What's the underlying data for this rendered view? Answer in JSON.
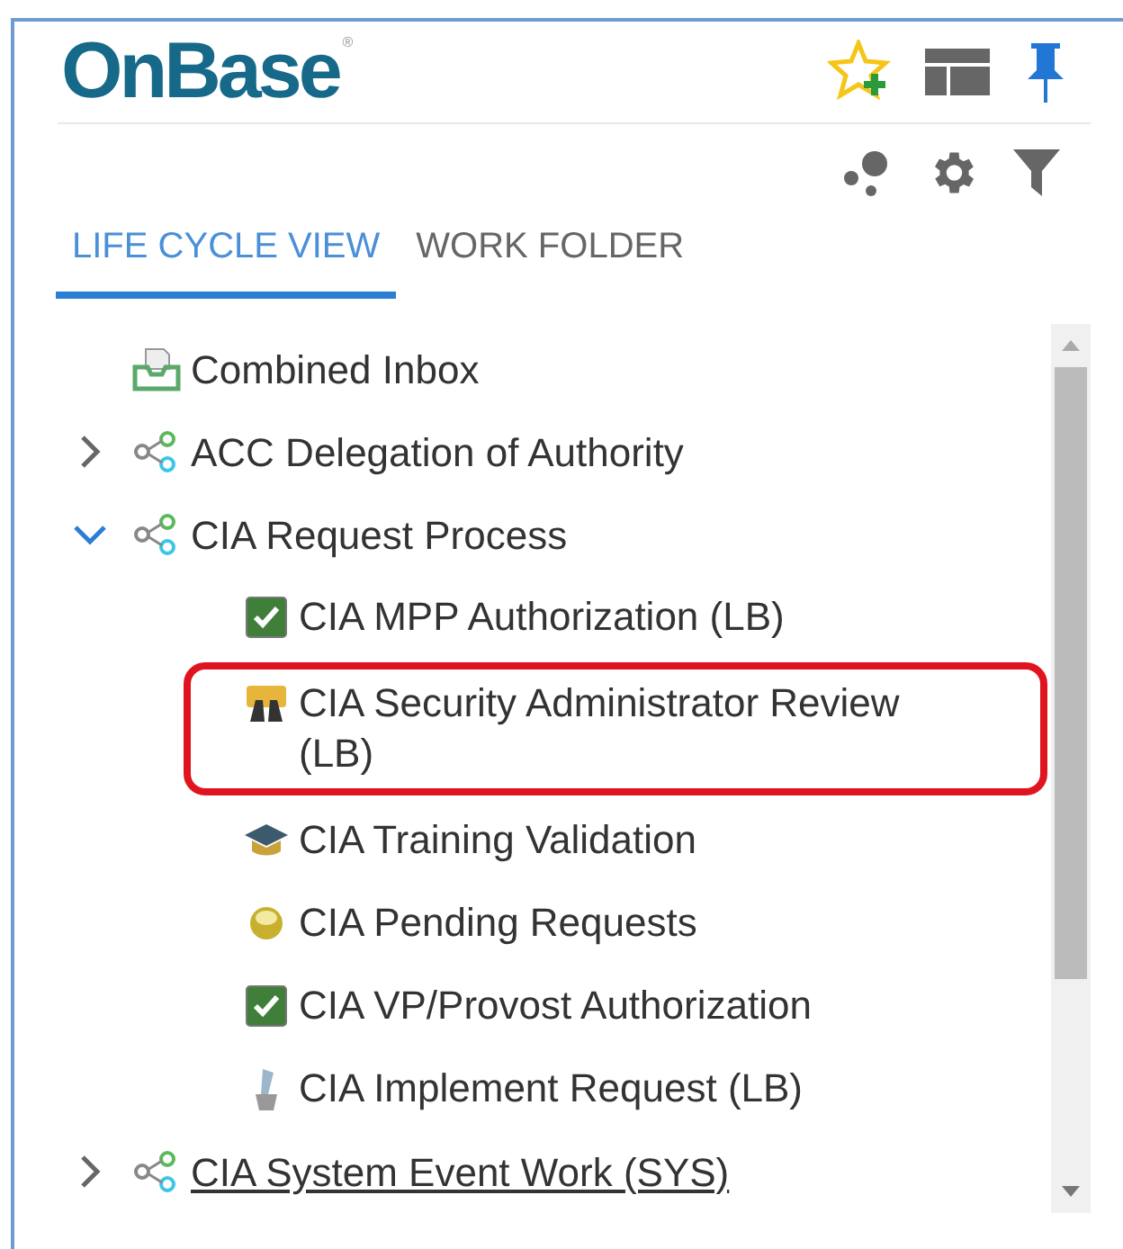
{
  "logo": {
    "name": "OnBase",
    "mark": "®"
  },
  "tabs": [
    {
      "label": "LIFE CYCLE VIEW",
      "selected": true
    },
    {
      "label": "WORK FOLDER",
      "selected": false
    }
  ],
  "tree": [
    {
      "kind": "inbox",
      "label": "Combined Inbox",
      "hovered": false
    },
    {
      "kind": "lifecycle",
      "label": "ACC Delegation of Authority",
      "expanded": false,
      "hovered": false
    },
    {
      "kind": "lifecycle",
      "label": "CIA Request Process",
      "expanded": true,
      "hovered": false,
      "children": [
        {
          "kind": "check",
          "label": "CIA MPP Authorization (LB)",
          "annotated": false
        },
        {
          "kind": "binoculars",
          "label": "CIA Security Administrator Review (LB)",
          "annotated": true
        },
        {
          "kind": "graduation",
          "label": "CIA Training Validation",
          "annotated": false
        },
        {
          "kind": "coin",
          "label": "CIA Pending Requests",
          "annotated": false
        },
        {
          "kind": "check",
          "label": "CIA VP/Provost Authorization",
          "annotated": false
        },
        {
          "kind": "pen",
          "label": "CIA Implement Request (LB)",
          "annotated": false
        }
      ]
    },
    {
      "kind": "lifecycle",
      "label": "CIA System Event Work (SYS)",
      "expanded": false,
      "hovered": true
    }
  ]
}
